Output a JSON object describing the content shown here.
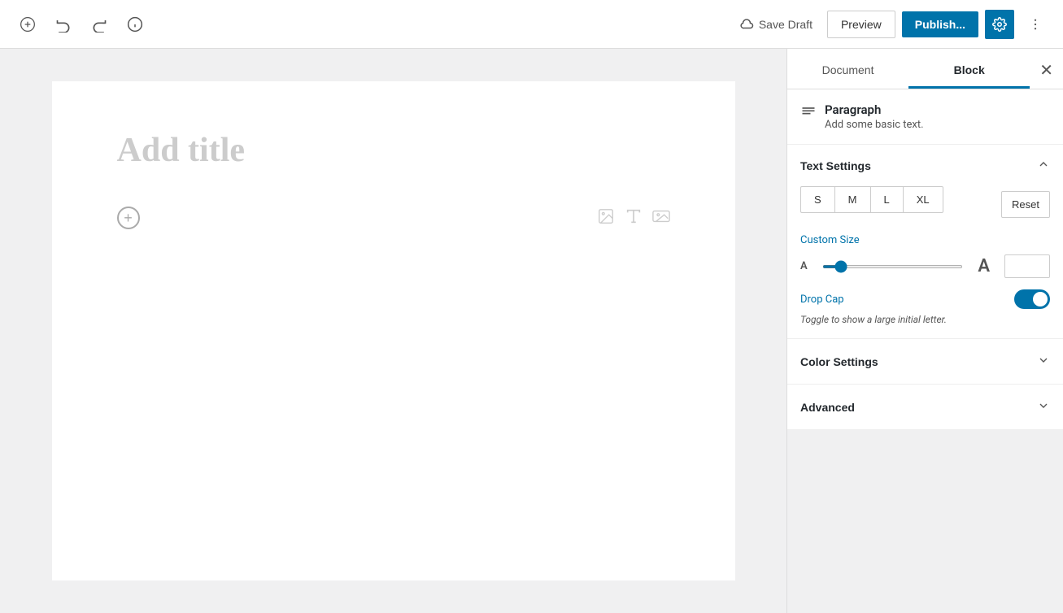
{
  "toolbar": {
    "save_draft_label": "Save Draft",
    "preview_label": "Preview",
    "publish_label": "Publish...",
    "undo_icon": "undo-icon",
    "redo_icon": "redo-icon",
    "add_icon": "add-icon",
    "info_icon": "info-icon",
    "settings_icon": "settings-icon",
    "more_icon": "more-options-icon"
  },
  "editor": {
    "title_placeholder": "Add title"
  },
  "sidebar": {
    "tabs": [
      {
        "label": "Document",
        "id": "document"
      },
      {
        "label": "Block",
        "id": "block"
      }
    ],
    "active_tab": "block",
    "block_info": {
      "name": "Paragraph",
      "description": "Add some basic text."
    },
    "text_settings": {
      "title": "Text Settings",
      "sizes": [
        "S",
        "M",
        "L",
        "XL"
      ],
      "reset_label": "Reset",
      "custom_size_label": "Custom Size",
      "font_small": "A",
      "font_large": "A",
      "drop_cap_label": "Drop Cap",
      "drop_cap_desc": "Toggle to show a large initial letter.",
      "drop_cap_enabled": true
    },
    "color_settings": {
      "title": "Color Settings"
    },
    "advanced": {
      "title": "Advanced"
    }
  }
}
